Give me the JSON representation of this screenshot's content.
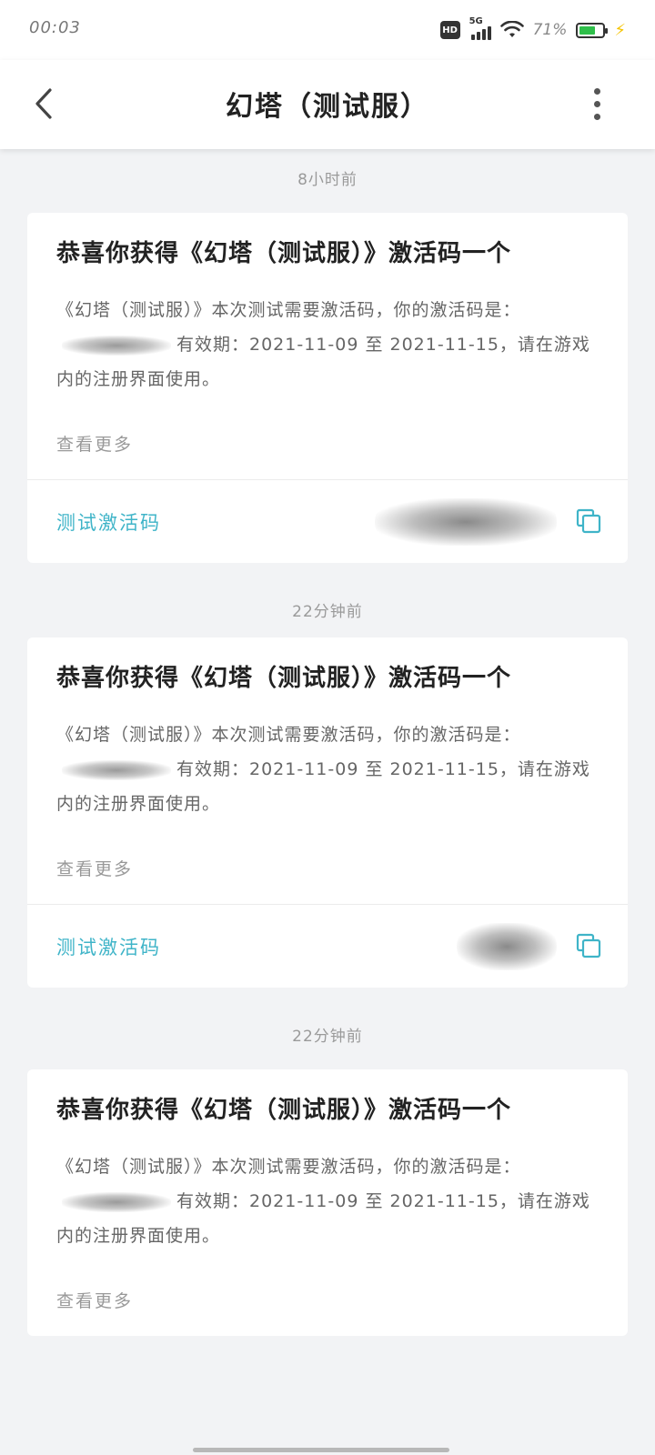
{
  "status": {
    "time": "00:03",
    "hd_badge": "HD",
    "network": "5G",
    "battery_percent": "71%",
    "battery_level": 0.71,
    "battery_color": "#2fbf4a",
    "icons": [
      "hd-icon",
      "signal-icon",
      "wifi-icon",
      "battery-icon",
      "charging-icon"
    ]
  },
  "app_bar": {
    "title": "幻塔（测试服）",
    "back_icon": "chevron-left-icon",
    "more_icon": "more-vertical-icon"
  },
  "accent_color": "#3fb4c8",
  "messages": [
    {
      "time_ago": "8小时前",
      "title": "恭喜你获得《幻塔（测试服）》激活码一个",
      "desc_prefix": "《幻塔（测试服）》本次测试需要激活码，你的激活码是：",
      "desc_suffix": "有效期：2021-11-09 至 2021-11-15，请在游戏内的注册界面使用。",
      "view_more": "查看更多",
      "code_label": "测试激活码"
    },
    {
      "time_ago": "22分钟前",
      "title": "恭喜你获得《幻塔（测试服）》激活码一个",
      "desc_prefix": "《幻塔（测试服）》本次测试需要激活码，你的激活码是：",
      "desc_suffix": "有效期：2021-11-09 至 2021-11-15，请在游戏内的注册界面使用。",
      "view_more": "查看更多",
      "code_label": "测试激活码"
    },
    {
      "time_ago": "22分钟前",
      "title": "恭喜你获得《幻塔（测试服）》激活码一个",
      "desc_prefix": "《幻塔（测试服）》本次测试需要激活码，你的激活码是：",
      "desc_suffix": "有效期：2021-11-09 至 2021-11-15，请在游戏内的注册界面使用。",
      "view_more": "查看更多"
    }
  ]
}
